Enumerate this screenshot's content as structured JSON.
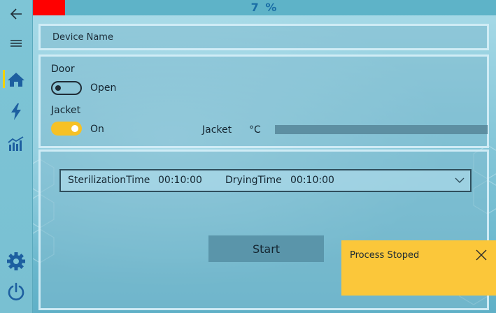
{
  "header": {
    "progress_text": "7 %",
    "progress_fraction": 0.07,
    "progress_color": "#ff0000"
  },
  "sidebar": {
    "items": [
      {
        "icon": "back-arrow-icon"
      },
      {
        "icon": "hamburger-menu-icon"
      },
      {
        "icon": "home-icon",
        "active": true
      },
      {
        "icon": "lightning-icon"
      },
      {
        "icon": "bar-chart-icon"
      },
      {
        "icon": "gear-icon"
      },
      {
        "icon": "power-icon"
      }
    ],
    "active_color": "#f2d200",
    "icon_color": "#1d5fa0"
  },
  "device": {
    "name_label": "Device Name"
  },
  "controls": {
    "door": {
      "label": "Door",
      "state_label": "Open",
      "on": false
    },
    "jacket": {
      "label": "Jacket",
      "state_label": "On",
      "on": true,
      "toggle_color": "#f6c125"
    },
    "jacket_temp": {
      "label": "Jacket",
      "unit": "°C",
      "value": ""
    }
  },
  "process": {
    "sterilization_label": "SterilizationTime",
    "sterilization_value": "00:10:00",
    "drying_label": "DryingTime",
    "drying_value": "00:10:00",
    "start_label": "Start"
  },
  "toast": {
    "message": "Process Stoped",
    "color": "#fbc73a"
  }
}
